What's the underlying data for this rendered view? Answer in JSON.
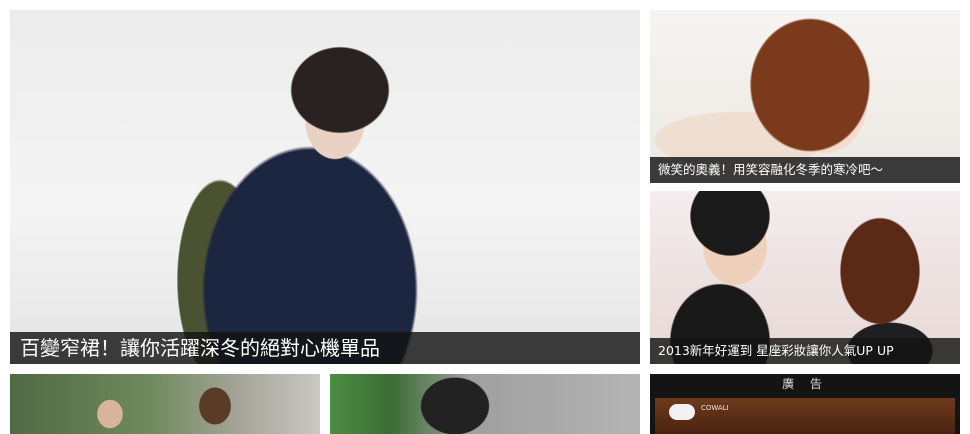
{
  "feature": {
    "caption": "百變窄裙！讓你活躍深冬的絕對心機單品"
  },
  "side_cards": [
    {
      "caption": "微笑的奧義！用笑容融化冬季的寒冷吧～"
    },
    {
      "caption": "2013新年好運到 星座彩妝讓你人氣UP UP"
    }
  ],
  "ad": {
    "title": "廣 告",
    "logo_text": "COWALI"
  }
}
